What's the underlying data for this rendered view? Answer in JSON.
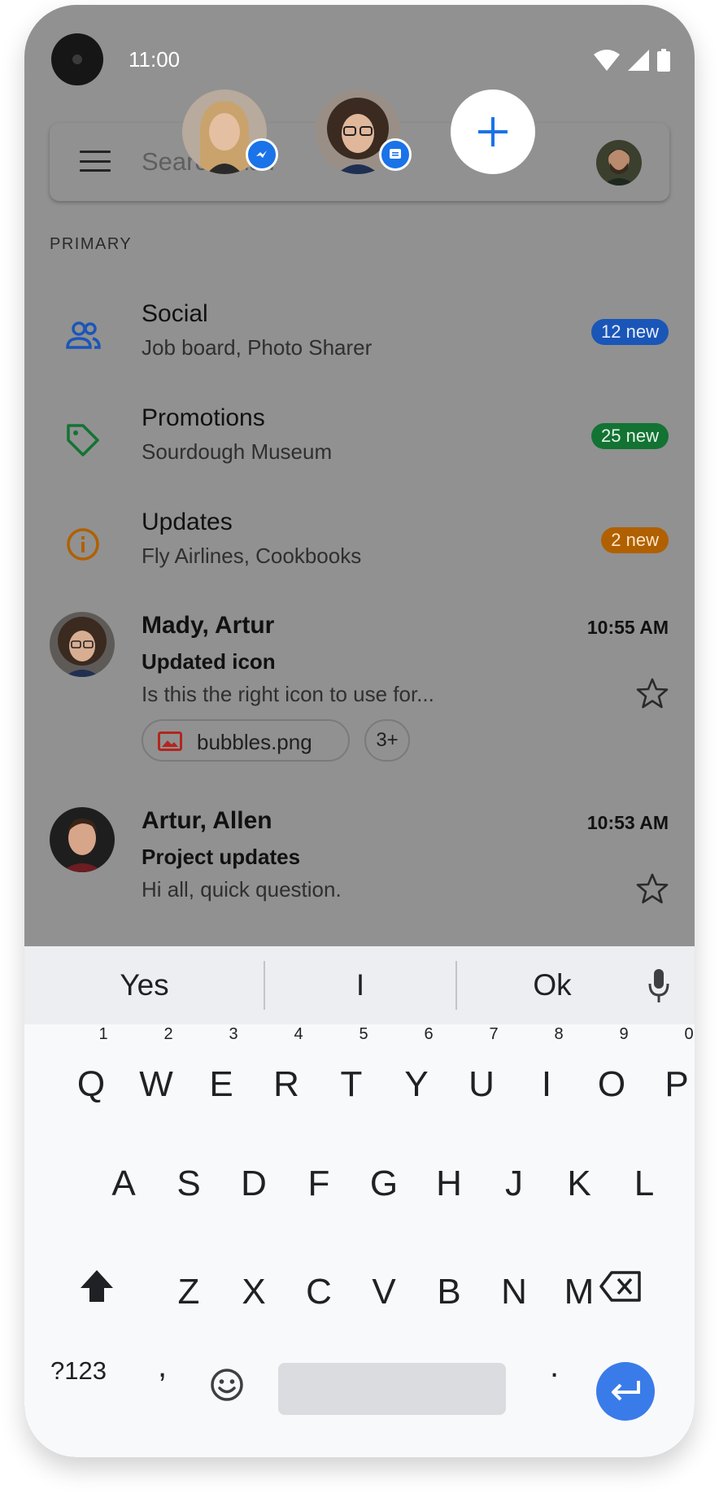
{
  "status_bar": {
    "time": "11:00"
  },
  "search": {
    "placeholder": "Search mail"
  },
  "bubbles": [
    {
      "name": "chat-head-1",
      "app": "messenger-icon"
    },
    {
      "name": "chat-head-2",
      "app": "messages-icon"
    }
  ],
  "section": {
    "label": "PRIMARY"
  },
  "categories": [
    {
      "title": "Social",
      "subtitle": "Job board, Photo Sharer",
      "badge": "12 new",
      "badge_color": "#1a56b8",
      "icon": "people-icon",
      "icon_color": "#1a56b8"
    },
    {
      "title": "Promotions",
      "subtitle": "Sourdough Museum",
      "badge": "25 new",
      "badge_color": "#137333",
      "icon": "tag-icon",
      "icon_color": "#137333"
    },
    {
      "title": "Updates",
      "subtitle": "Fly Airlines, Cookbooks",
      "badge": "2 new",
      "badge_color": "#b06000",
      "icon": "info-icon",
      "icon_color": "#b06000"
    }
  ],
  "emails": [
    {
      "from": "Mady, Artur",
      "time": "10:55 AM",
      "subject": "Updated icon",
      "snippet": "Is this the right icon to use for...",
      "attachment": "bubbles.png",
      "more": "3+"
    },
    {
      "from": "Artur, Allen",
      "time": "10:53 AM",
      "subject": "Project updates",
      "snippet": "Hi all, quick question."
    }
  ],
  "keyboard": {
    "suggestions": [
      "Yes",
      "I",
      "Ok"
    ],
    "row1": [
      "Q",
      "W",
      "E",
      "R",
      "T",
      "Y",
      "U",
      "I",
      "O",
      "P"
    ],
    "row1_hints": [
      "1",
      "2",
      "3",
      "4",
      "5",
      "6",
      "7",
      "8",
      "9",
      "0"
    ],
    "row2": [
      "A",
      "S",
      "D",
      "F",
      "G",
      "H",
      "J",
      "K",
      "L"
    ],
    "row3": [
      "Z",
      "X",
      "C",
      "V",
      "B",
      "N",
      "M"
    ],
    "symbols": "?123",
    "comma": ",",
    "period": "."
  },
  "colors": {
    "accent": "#1a73e8",
    "enter": "#3a7bea",
    "scrim": "#919191"
  }
}
